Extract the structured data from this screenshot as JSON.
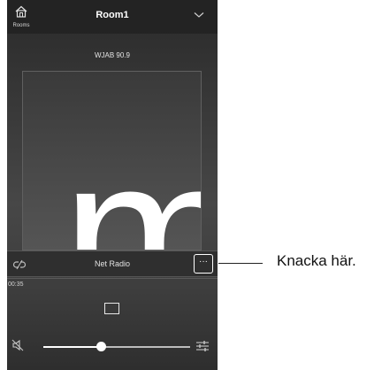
{
  "header": {
    "rooms_label": "Rooms",
    "title": "Room1"
  },
  "now_playing": {
    "station": "WJAB 90.9",
    "artwork_letter": "m"
  },
  "source_bar": {
    "label": "Net Radio",
    "more_label": "···"
  },
  "playback": {
    "elapsed": "00:35"
  },
  "volume": {
    "level": 0.39
  },
  "callout": {
    "text": "Knacka här."
  },
  "colors": {
    "highlight": "#ffffff",
    "panel": "#2f2f2f",
    "header": "#232323"
  }
}
